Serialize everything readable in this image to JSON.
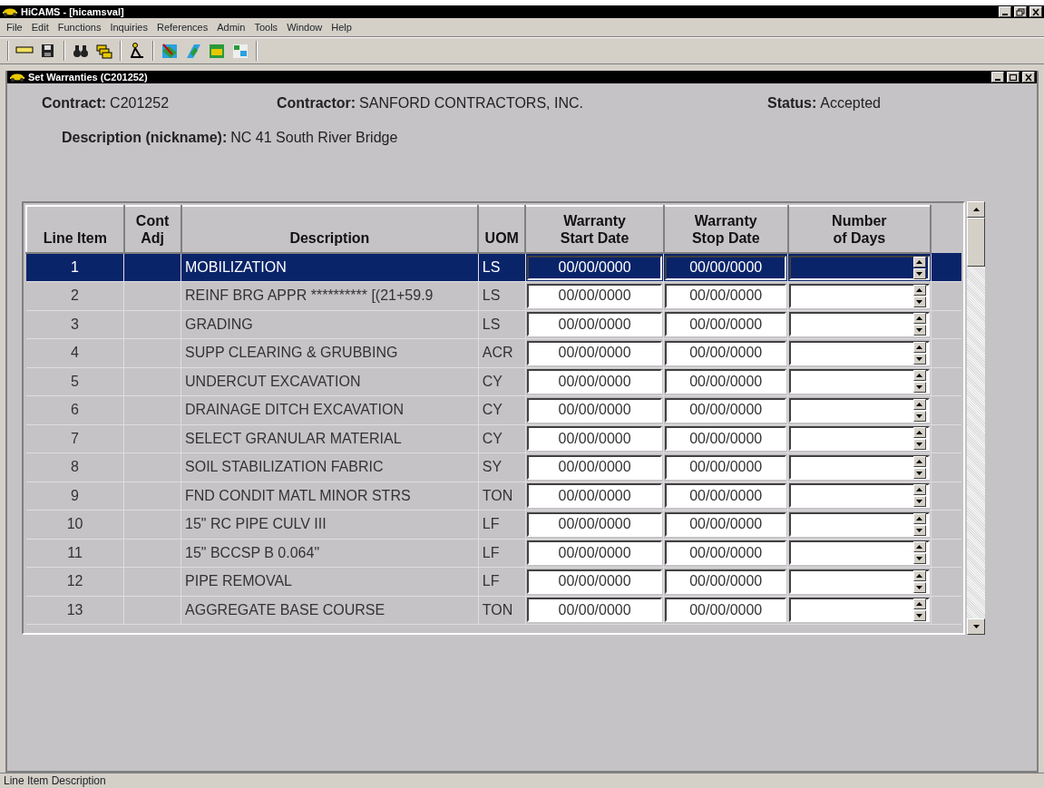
{
  "window": {
    "title": "HiCAMS - [hicamsval]"
  },
  "menu": [
    "File",
    "Edit",
    "Functions",
    "Inquiries",
    "References",
    "Admin",
    "Tools",
    "Window",
    "Help"
  ],
  "child_window": {
    "title": "Set Warranties (C201252)"
  },
  "header": {
    "fields": [
      {
        "label": "Contract:",
        "value": "C201252"
      },
      {
        "label": "Contractor:",
        "value": "SANFORD CONTRACTORS, INC."
      },
      {
        "label": "Status:",
        "value": "Accepted"
      }
    ],
    "description": {
      "label": "Description (nickname):",
      "value": "NC 41 South River Bridge"
    }
  },
  "table": {
    "columns": [
      "Line Item",
      "Cont\nAdj",
      "Description",
      "UOM",
      "Warranty\nStart Date",
      "Warranty\nStop Date",
      "Number\nof Days"
    ],
    "rows": [
      {
        "line_item": "1",
        "description": "MOBILIZATION",
        "uom": "LS",
        "start_date": "00/00/0000",
        "stop_date": "00/00/0000",
        "selected": true
      },
      {
        "line_item": "2",
        "description": "REINF BRG APPR ********** [(21+59.9",
        "uom": "LS",
        "start_date": "00/00/0000",
        "stop_date": "00/00/0000",
        "selected": false
      },
      {
        "line_item": "3",
        "description": "GRADING",
        "uom": "LS",
        "start_date": "00/00/0000",
        "stop_date": "00/00/0000",
        "selected": false
      },
      {
        "line_item": "4",
        "description": "SUPP CLEARING & GRUBBING",
        "uom": "ACR",
        "start_date": "00/00/0000",
        "stop_date": "00/00/0000",
        "selected": false
      },
      {
        "line_item": "5",
        "description": "UNDERCUT EXCAVATION",
        "uom": "CY",
        "start_date": "00/00/0000",
        "stop_date": "00/00/0000",
        "selected": false
      },
      {
        "line_item": "6",
        "description": "DRAINAGE DITCH EXCAVATION",
        "uom": "CY",
        "start_date": "00/00/0000",
        "stop_date": "00/00/0000",
        "selected": false
      },
      {
        "line_item": "7",
        "description": "SELECT GRANULAR MATERIAL",
        "uom": "CY",
        "start_date": "00/00/0000",
        "stop_date": "00/00/0000",
        "selected": false
      },
      {
        "line_item": "8",
        "description": "SOIL STABILIZATION FABRIC",
        "uom": "SY",
        "start_date": "00/00/0000",
        "stop_date": "00/00/0000",
        "selected": false
      },
      {
        "line_item": "9",
        "description": "FND CONDIT MATL MINOR STRS",
        "uom": "TON",
        "start_date": "00/00/0000",
        "stop_date": "00/00/0000",
        "selected": false
      },
      {
        "line_item": "10",
        "description": "15\" RC PIPE CULV III",
        "uom": "LF",
        "start_date": "00/00/0000",
        "stop_date": "00/00/0000",
        "selected": false
      },
      {
        "line_item": "11",
        "description": "15\" BCCSP B 0.064\"",
        "uom": "LF",
        "start_date": "00/00/0000",
        "stop_date": "00/00/0000",
        "selected": false
      },
      {
        "line_item": "12",
        "description": "PIPE REMOVAL",
        "uom": "LF",
        "start_date": "00/00/0000",
        "stop_date": "00/00/0000",
        "selected": false
      },
      {
        "line_item": "13",
        "description": "AGGREGATE BASE COURSE",
        "uom": "TON",
        "start_date": "00/00/0000",
        "stop_date": "00/00/0000",
        "selected": false
      }
    ]
  },
  "status_bar": "Line Item Description"
}
